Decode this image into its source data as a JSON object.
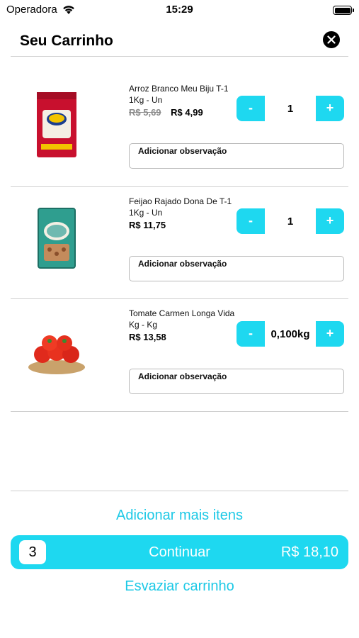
{
  "status_bar": {
    "carrier": "Operadora",
    "time": "15:29"
  },
  "header": {
    "title": "Seu Carrinho",
    "close_icon": "close-icon"
  },
  "colors": {
    "accent": "#1ed8f0",
    "link": "#1ec9e6"
  },
  "items": [
    {
      "name": "Arroz Branco Meu Biju T-1 1Kg - Un",
      "old_price": "R$ 5,69",
      "price": "R$ 4,99",
      "qty_minus": "-",
      "qty_plus": "+",
      "quantity": "1",
      "observation": "Adicionar observação"
    },
    {
      "name": "Feijao Rajado Dona De T-1 1Kg  - Un",
      "price": "R$ 11,75",
      "qty_minus": "-",
      "qty_plus": "+",
      "quantity": "1",
      "observation": "Adicionar observação"
    },
    {
      "name": "Tomate Carmen Longa Vida Kg - Kg",
      "price": "R$ 13,58",
      "qty_minus": "-",
      "qty_plus": "+",
      "quantity": "0,100kg",
      "observation": "Adicionar observação"
    }
  ],
  "footer": {
    "add_more": "Adicionar mais itens",
    "item_count": "3",
    "continue_label": "Continuar",
    "total": "R$ 18,10",
    "empty_cart": "Esvaziar carrinho"
  }
}
